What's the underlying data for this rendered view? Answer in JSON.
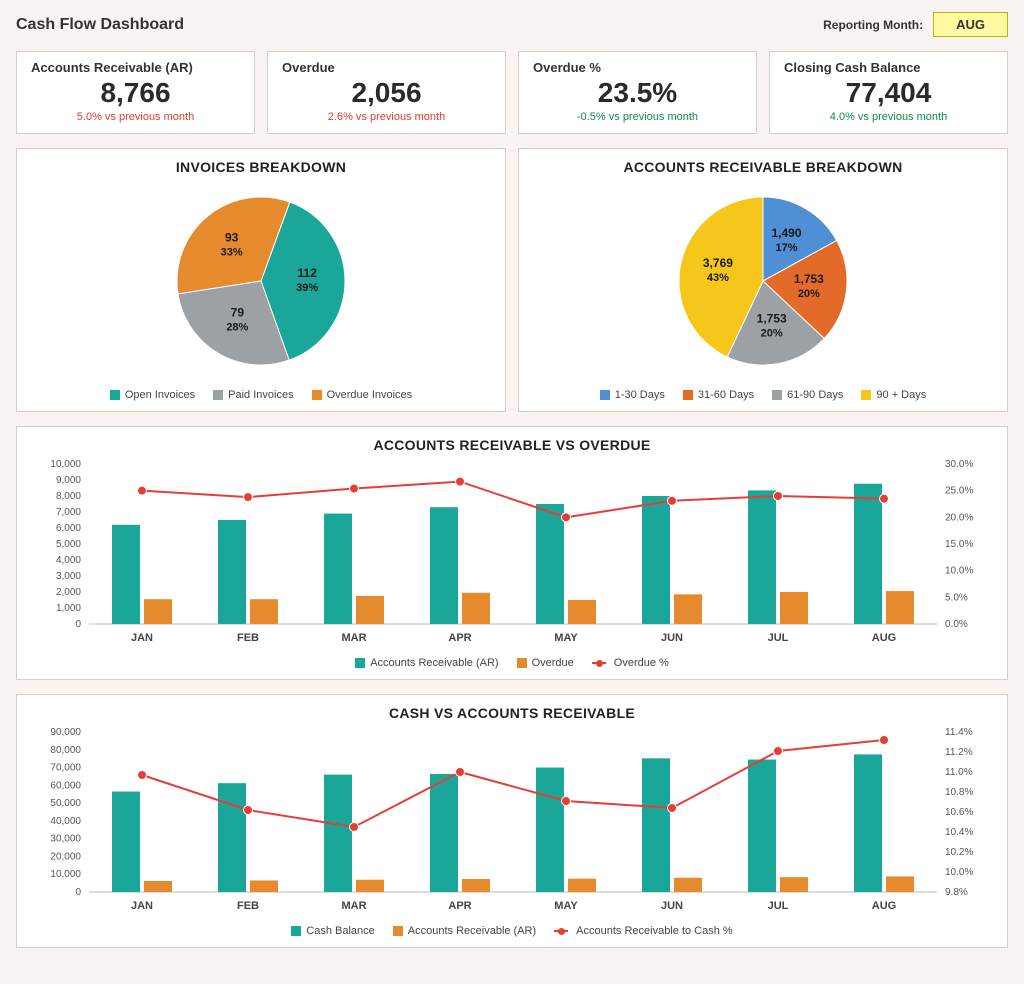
{
  "header": {
    "title": "Cash Flow Dashboard",
    "reporting_label": "Reporting Month:",
    "reporting_value": "AUG"
  },
  "kpis": [
    {
      "label": "Accounts Receivable (AR)",
      "value": "8,766",
      "change": "5.0% vs previous month",
      "direction": "neg"
    },
    {
      "label": "Overdue",
      "value": "2,056",
      "change": "2.6% vs previous month",
      "direction": "neg"
    },
    {
      "label": "Overdue %",
      "value": "23.5%",
      "change": "-0.5% vs previous month",
      "direction": "pos"
    },
    {
      "label": "Closing Cash Balance",
      "value": "77,404",
      "change": "4.0% vs previous month",
      "direction": "pos"
    }
  ],
  "invoices_pie": {
    "title": "INVOICES BREAKDOWN",
    "legend": [
      "Open Invoices",
      "Paid Invoices",
      "Overdue Invoices"
    ],
    "colors": [
      "#1aa699",
      "#9bA1a5",
      "#e68a2e"
    ],
    "slices": [
      {
        "label": "112",
        "pct": "39%"
      },
      {
        "label": "79",
        "pct": "28%"
      },
      {
        "label": "93",
        "pct": "33%"
      }
    ]
  },
  "ar_pie": {
    "title": "ACCOUNTS RECEIVABLE BREAKDOWN",
    "legend": [
      "1-30 Days",
      "31-60 Days",
      "61-90 Days",
      "90 + Days"
    ],
    "colors": [
      "#4e8fd6",
      "#e36a29",
      "#9bA1a5",
      "#f6c71a"
    ],
    "slices": [
      {
        "label": "1,490",
        "pct": "17%"
      },
      {
        "label": "1,753",
        "pct": "20%"
      },
      {
        "label": "1,753",
        "pct": "20%"
      },
      {
        "label": "3,769",
        "pct": "43%"
      }
    ]
  },
  "combo1": {
    "title": "ACCOUNTS RECEIVABLE VS OVERDUE",
    "categories": [
      "JAN",
      "FEB",
      "MAR",
      "APR",
      "MAY",
      "JUN",
      "JUL",
      "AUG"
    ],
    "y1_ticks": [
      "0",
      "1,000",
      "2,000",
      "3,000",
      "4,000",
      "5,000",
      "6,000",
      "7,000",
      "8,000",
      "9,000",
      "10,000"
    ],
    "y2_ticks": [
      "0.0%",
      "5.0%",
      "10.0%",
      "15.0%",
      "20.0%",
      "25.0%",
      "30.0%"
    ],
    "legend": [
      "Accounts Receivable (AR)",
      "Overdue",
      "Overdue %"
    ]
  },
  "combo2": {
    "title": "CASH VS ACCOUNTS RECEIVABLE",
    "categories": [
      "JAN",
      "FEB",
      "MAR",
      "APR",
      "MAY",
      "JUN",
      "JUL",
      "AUG"
    ],
    "y1_ticks": [
      "0",
      "10,000",
      "20,000",
      "30,000",
      "40,000",
      "50,000",
      "60,000",
      "70,000",
      "80,000",
      "90,000"
    ],
    "y2_ticks": [
      "9.8%",
      "10.0%",
      "10.2%",
      "10.4%",
      "10.6%",
      "10.8%",
      "11.0%",
      "11.2%",
      "11.4%"
    ],
    "legend": [
      "Cash Balance",
      "Accounts Receivable (AR)",
      "Accounts Receivable to Cash %"
    ]
  },
  "chart_data": [
    {
      "type": "pie",
      "title": "INVOICES BREAKDOWN",
      "series": [
        {
          "name": "Open Invoices",
          "value": 112,
          "pct": 39,
          "color": "#1aa699"
        },
        {
          "name": "Paid Invoices",
          "value": 79,
          "pct": 28,
          "color": "#9bA1a5"
        },
        {
          "name": "Overdue Invoices",
          "value": 93,
          "pct": 33,
          "color": "#e68a2e"
        }
      ]
    },
    {
      "type": "pie",
      "title": "ACCOUNTS RECEIVABLE BREAKDOWN",
      "series": [
        {
          "name": "1-30 Days",
          "value": 1490,
          "pct": 17,
          "color": "#4e8fd6"
        },
        {
          "name": "31-60 Days",
          "value": 1753,
          "pct": 20,
          "color": "#e36a29"
        },
        {
          "name": "61-90 Days",
          "value": 1753,
          "pct": 20,
          "color": "#9bA1a5"
        },
        {
          "name": "90 + Days",
          "value": 3769,
          "pct": 43,
          "color": "#f6c71a"
        }
      ]
    },
    {
      "type": "bar_line_combo",
      "title": "ACCOUNTS RECEIVABLE VS OVERDUE",
      "categories": [
        "JAN",
        "FEB",
        "MAR",
        "APR",
        "MAY",
        "JUN",
        "JUL",
        "AUG"
      ],
      "y1lim": [
        0,
        10000
      ],
      "y2lim": [
        0,
        30
      ],
      "series": [
        {
          "name": "Accounts Receivable (AR)",
          "type": "bar",
          "axis": "y1",
          "color": "#1aa699",
          "values": [
            6200,
            6500,
            6900,
            7300,
            7500,
            8000,
            8350,
            8766
          ]
        },
        {
          "name": "Overdue",
          "type": "bar",
          "axis": "y1",
          "color": "#e68a2e",
          "values": [
            1550,
            1550,
            1750,
            1950,
            1500,
            1850,
            2000,
            2056
          ]
        },
        {
          "name": "Overdue %",
          "type": "line",
          "axis": "y2",
          "color": "#e63e36",
          "values": [
            25.0,
            23.8,
            25.4,
            26.7,
            20.0,
            23.1,
            24.0,
            23.5
          ]
        }
      ]
    },
    {
      "type": "bar_line_combo",
      "title": "CASH VS ACCOUNTS RECEIVABLE",
      "categories": [
        "JAN",
        "FEB",
        "MAR",
        "APR",
        "MAY",
        "JUN",
        "JUL",
        "AUG"
      ],
      "y1lim": [
        0,
        90000
      ],
      "y2lim": [
        9.8,
        11.4
      ],
      "series": [
        {
          "name": "Cash Balance",
          "type": "bar",
          "axis": "y1",
          "color": "#1aa699",
          "values": [
            56500,
            61200,
            66000,
            66400,
            70000,
            75200,
            74500,
            77404
          ]
        },
        {
          "name": "Accounts Receivable (AR)",
          "type": "bar",
          "axis": "y1",
          "color": "#e68a2e",
          "values": [
            6200,
            6500,
            6900,
            7300,
            7500,
            8000,
            8350,
            8766
          ]
        },
        {
          "name": "Accounts Receivable to Cash %",
          "type": "line",
          "axis": "y2",
          "color": "#e63e36",
          "values": [
            10.97,
            10.62,
            10.45,
            11.0,
            10.71,
            10.64,
            11.21,
            11.32
          ]
        }
      ]
    }
  ]
}
